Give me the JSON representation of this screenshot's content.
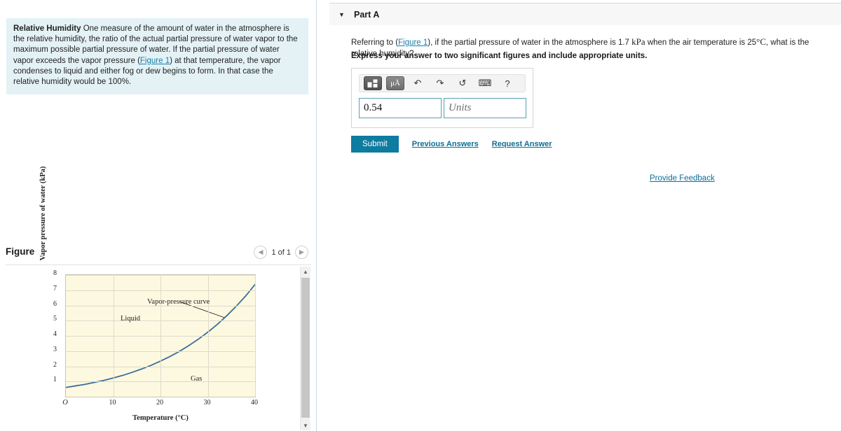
{
  "intro": {
    "title": "Relative Humidity",
    "body_1": " One measure of the amount of water in the atmosphere is the relative humidity, the ratio of the actual partial pressure of water vapor to the maximum possible partial pressure of water. If the partial pressure of water vapor exceeds the vapor pressure (",
    "figure_link": "Figure 1",
    "body_2": ") at that temperature, the vapor condenses to liquid and either fog or dew begins to form. In that case the relative humidity would be 100%."
  },
  "figure_panel": {
    "title": "Figure",
    "pager": {
      "prev_icon": "chevron-left-icon",
      "count": "1 of 1",
      "next_icon": "chevron-right-icon"
    }
  },
  "part": {
    "caret": "▼",
    "title": "Part A",
    "question_prefix": "Referring to (",
    "question_link": "Figure 1",
    "question_mid": "), if the partial pressure of water in the atmosphere is 1.7 ",
    "question_unit1": "kPa",
    "question_mid2": " when the air temperature is 25",
    "question_unit2": "°C",
    "question_suffix": ", what is the relative humidity?",
    "instruction": "Express your answer to two significant figures and include appropriate units."
  },
  "toolbar": {
    "template_icon": "math-template-icon",
    "units_label": "μÅ",
    "undo_icon": "↶",
    "redo_icon": "↷",
    "reset_icon": "↺",
    "keyboard_icon": "⌨",
    "help_icon": "?"
  },
  "answer": {
    "value": "0.54",
    "units_placeholder": "Units"
  },
  "actions": {
    "submit": "Submit",
    "previous_answers": "Previous Answers",
    "request_answer": "Request Answer",
    "provide_feedback": "Provide Feedback"
  },
  "colors": {
    "accent": "#0e7ba0",
    "link": "#0c6e95",
    "intro_bg": "#e4f2f6",
    "plot_bg": "#fdf8e0",
    "curve": "#3c6e98"
  },
  "chart_data": {
    "type": "line",
    "title": "",
    "xlabel": "Temperature (°C)",
    "ylabel": "Vapor pressure of water (kPa)",
    "xlim": [
      0,
      40
    ],
    "ylim": [
      0,
      8
    ],
    "xticks": [
      0,
      10,
      20,
      30,
      40
    ],
    "xtick_labels": [
      "O",
      "10",
      "20",
      "30",
      "40"
    ],
    "yticks": [
      1,
      2,
      3,
      4,
      5,
      6,
      7,
      8
    ],
    "ytick_labels": [
      "1",
      "2",
      "3",
      "4",
      "5",
      "6",
      "7",
      "8"
    ],
    "grid": true,
    "legend": "none",
    "series": [
      {
        "name": "Vapor-pressure curve",
        "color": "#3c6e98",
        "x": [
          0,
          2,
          4,
          6,
          8,
          10,
          12,
          14,
          16,
          18,
          20,
          22,
          24,
          26,
          28,
          30,
          32,
          34,
          36,
          38,
          40
        ],
        "y": [
          0.61,
          0.71,
          0.81,
          0.94,
          1.07,
          1.23,
          1.4,
          1.6,
          1.82,
          2.06,
          2.34,
          2.64,
          2.98,
          3.36,
          3.78,
          4.24,
          4.75,
          5.32,
          5.94,
          6.62,
          7.38
        ]
      }
    ],
    "annotations": [
      {
        "text": "Liquid",
        "x": 11.5,
        "y": 5.5
      },
      {
        "text": "Gas",
        "x": 26.5,
        "y": 1.6
      },
      {
        "text": "Vapor-pressure curve",
        "x": 17.5,
        "y": 6.6,
        "leader_to": {
          "x": 33.5,
          "y": 5.2
        }
      }
    ]
  }
}
